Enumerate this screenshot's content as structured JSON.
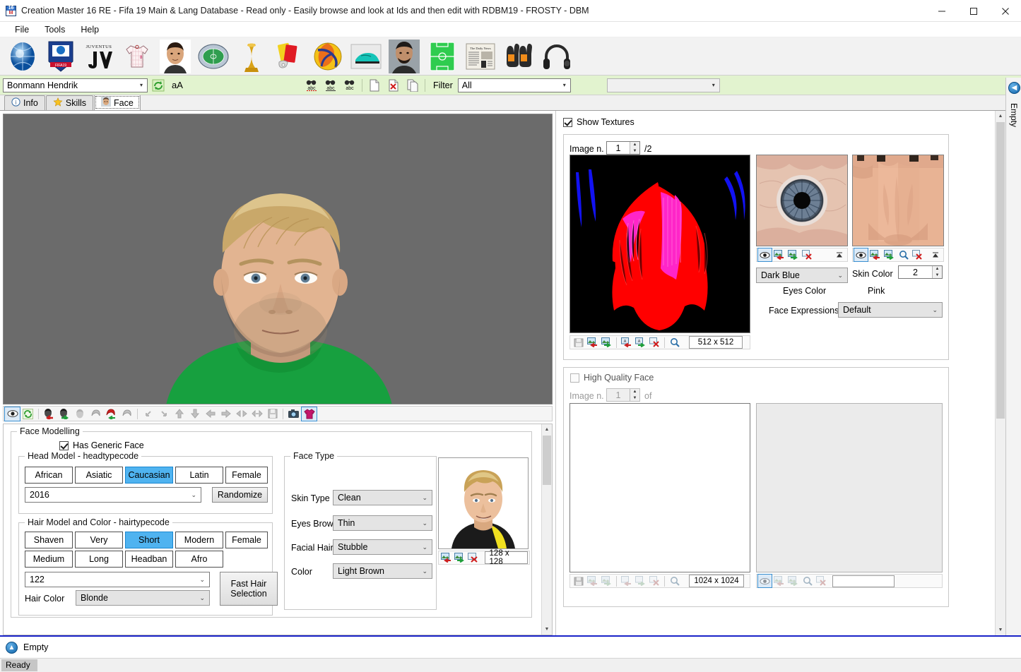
{
  "window": {
    "title": "Creation Master 16 RE - Fifa 19 Main & Lang Database - Read only - Easily browse and look at Ids and then edit with RDBM19 - FROSTY - DBM",
    "icon_top": "16",
    "icon_bottom": "M",
    "minimize": "–",
    "maximize": "☐",
    "close": "✕"
  },
  "menu": {
    "items": [
      "File",
      "Tools",
      "Help"
    ]
  },
  "toolbar": {
    "icons": [
      "world-globe-icon",
      "league-badge-icon",
      "juventus-logo-icon",
      "jersey-kit-icon",
      "player-portrait-icon",
      "stadium-icon",
      "world-cup-trophy-icon",
      "referee-cards-whistle-icon",
      "football-ball-icon",
      "football-boot-icon",
      "manager-portrait-icon",
      "pitch-tactics-icon",
      "newspaper-icon",
      "goalkeeper-gloves-icon",
      "headphones-icon"
    ]
  },
  "navbar": {
    "player_name": "Bonmann Hendrik",
    "refresh_icon": "refresh-icon",
    "case_button": "aA",
    "search_icons": [
      "search-abc-icon",
      "search-abc-icon",
      "search-abc-icon"
    ],
    "doc_icons": [
      "new-record-icon",
      "delete-record-icon",
      "copy-record-icon"
    ],
    "filter_label": "Filter",
    "filter_value": "All",
    "extra_combo_value": ""
  },
  "tabs": [
    {
      "label": "Info",
      "icon": "info-icon",
      "active": false
    },
    {
      "label": "Skills",
      "icon": "star-icon",
      "active": false
    },
    {
      "label": "Face",
      "icon": "face-icon",
      "active": true
    }
  ],
  "viewer_toolbar": {
    "icons": [
      "eye-preview-icon",
      "refresh-model-icon",
      "head-import-icon",
      "head-export-icon",
      "head-reset-icon",
      "hair-grey-icon",
      "hair-import-icon",
      "hair-export-icon",
      "rotate-up-left-icon",
      "rotate-down-right-icon",
      "move-up-icon",
      "move-down-icon",
      "move-left-icon",
      "move-right-icon",
      "flip-horizontal-icon",
      "swap-icon",
      "save-icon",
      "camera-snapshot-icon",
      "kit-shirt-icon"
    ]
  },
  "face_modelling": {
    "group_label": "Face Modelling",
    "has_generic_face": {
      "label": "Has Generic Face",
      "checked": true
    },
    "head_model": {
      "group_label": "Head Model - headtypecode",
      "buttons": [
        "African",
        "Asiatic",
        "Caucasian",
        "Latin",
        "Female"
      ],
      "selected": "Caucasian",
      "code_value": "2016",
      "randomize_label": "Randomize"
    },
    "hair_model": {
      "group_label": "Hair Model and Color - hairtypecode",
      "buttons_row1": [
        "Shaven",
        "Very",
        "Short",
        "Modern",
        "Female"
      ],
      "buttons_row2": [
        "Medium",
        "Long",
        "Headban",
        "Afro"
      ],
      "selected": "Short",
      "code_value": "122",
      "hair_color_label": "Hair Color",
      "hair_color_value": "Blonde",
      "fast_hair_label_line1": "Fast Hair",
      "fast_hair_label_line2": "Selection"
    }
  },
  "face_type": {
    "group_label": "Face Type",
    "fields": [
      {
        "label": "Skin Type",
        "value": "Clean"
      },
      {
        "label": "Eyes Brow",
        "value": "Thin"
      },
      {
        "label": "Facial Hair",
        "value": "Stubble"
      },
      {
        "label": "Color",
        "value": "Light Brown"
      }
    ],
    "photo_size": "128 x 128",
    "photo_icons": [
      "photo-import-icon",
      "photo-export-icon",
      "photo-delete-icon"
    ]
  },
  "textures": {
    "show_textures": {
      "label": "Show Textures",
      "checked": true
    },
    "image_label": "Image n.",
    "image_number": "1",
    "image_total": "/2",
    "hair_texture_size": "512 x 512",
    "hair_toolbar_icons": [
      "save-icon",
      "texture-import-icon",
      "texture-export-icon",
      "texture-load-icon",
      "texture-save-icon",
      "texture-delete-icon",
      "zoom-icon"
    ],
    "eye_toolbar_icons": [
      "eye-icon",
      "texture-import-icon",
      "texture-export-icon",
      "texture-delete-icon"
    ],
    "skin_toolbar_icons": [
      "eye-icon",
      "texture-import-icon",
      "texture-export-icon",
      "zoom-icon",
      "texture-delete-icon"
    ],
    "eyes_color_value": "Dark Blue",
    "eyes_color_label": "Eyes Color",
    "skin_color_label": "Skin Color",
    "skin_color_value": "2",
    "skin_tone_label": "Pink",
    "face_expressions_label": "Face Expressions",
    "face_expressions_value": "Default"
  },
  "high_quality_face": {
    "checkbox_label": "High Quality Face",
    "checked": false,
    "image_label": "Image n.",
    "image_number": "1",
    "of_label": "of",
    "size_value": "1024 x 1024",
    "left_toolbar_icons": [
      "save-icon",
      "import-icon",
      "export-icon",
      "load-icon",
      "store-icon",
      "delete-icon",
      "zoom-icon"
    ],
    "right_toolbar_icons": [
      "eye-icon",
      "import-icon",
      "export-icon",
      "zoom-icon",
      "delete-icon"
    ],
    "right_field_value": ""
  },
  "dock": {
    "label": "Empty",
    "icon": "back-arrow-icon"
  },
  "bottom": {
    "label": "Empty",
    "icon": "up-arrow-icon"
  },
  "status": {
    "text": "Ready"
  },
  "colors": {
    "accent_blue": "#4fb3f0",
    "navbar_green": "#e2f3cf",
    "bottom_rule": "#1a23c8",
    "hair_texture_red": "#ff0000",
    "hair_texture_magenta": "#ff25c8",
    "hair_texture_blue": "#1414ff",
    "skin_tone": "#e8b394",
    "iris_blue": "#6d7f94",
    "jersey_green": "#17a03f"
  }
}
